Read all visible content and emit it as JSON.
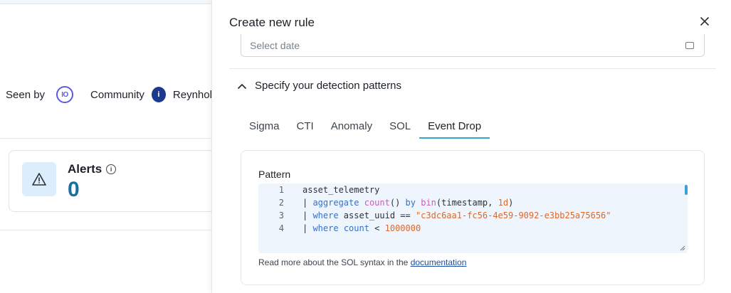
{
  "background": {
    "seen_by_label": "Seen by",
    "io_logo_text": "IO",
    "community_label": "Community",
    "community_logo_text": "i",
    "company_name": "Reynhol",
    "alerts_title": "Alerts",
    "alerts_count": "0"
  },
  "drawer": {
    "title": "Create new rule",
    "date_placeholder": "Select date",
    "section_title": "Specify your detection patterns",
    "tabs": [
      {
        "label": "Sigma",
        "active": false
      },
      {
        "label": "CTI",
        "active": false
      },
      {
        "label": "Anomaly",
        "active": false
      },
      {
        "label": "SOL",
        "active": false
      },
      {
        "label": "Event Drop",
        "active": true
      }
    ],
    "pattern_label": "Pattern",
    "code_lines": [
      {
        "n": "1",
        "parts": [
          {
            "t": "asset_telemetry",
            "c": "plain"
          }
        ]
      },
      {
        "n": "2",
        "parts": [
          {
            "t": "| ",
            "c": "plain"
          },
          {
            "t": "aggregate",
            "c": "kw"
          },
          {
            "t": " ",
            "c": "plain"
          },
          {
            "t": "count",
            "c": "fn"
          },
          {
            "t": "() ",
            "c": "plain"
          },
          {
            "t": "by",
            "c": "kw"
          },
          {
            "t": " ",
            "c": "plain"
          },
          {
            "t": "bin",
            "c": "fn"
          },
          {
            "t": "(timestamp, ",
            "c": "plain"
          },
          {
            "t": "1d",
            "c": "num"
          },
          {
            "t": ")",
            "c": "plain"
          }
        ]
      },
      {
        "n": "3",
        "parts": [
          {
            "t": "| ",
            "c": "plain"
          },
          {
            "t": "where",
            "c": "kw"
          },
          {
            "t": " asset_uuid == ",
            "c": "plain"
          },
          {
            "t": "\"c3dc6aa1-fc56-4e59-9092-e3bb25a75656\"",
            "c": "str"
          }
        ]
      },
      {
        "n": "4",
        "parts": [
          {
            "t": "| ",
            "c": "plain"
          },
          {
            "t": "where",
            "c": "kw"
          },
          {
            "t": " ",
            "c": "plain"
          },
          {
            "t": "count",
            "c": "kw"
          },
          {
            "t": " < ",
            "c": "plain"
          },
          {
            "t": "1000000",
            "c": "num"
          }
        ]
      }
    ],
    "help_prefix": "Read more about the SOL syntax in the ",
    "help_link": "documentation"
  },
  "colors": {
    "accent": "#38a6c9",
    "keyword": "#3671c9",
    "function": "#c65fb8",
    "string": "#e0682a",
    "alert_count": "#1a6fa0"
  },
  "icons": {
    "close": "close-icon",
    "calendar": "calendar-icon",
    "chevron": "chevron-up-icon",
    "warning": "warning-icon",
    "info": "info-icon"
  }
}
